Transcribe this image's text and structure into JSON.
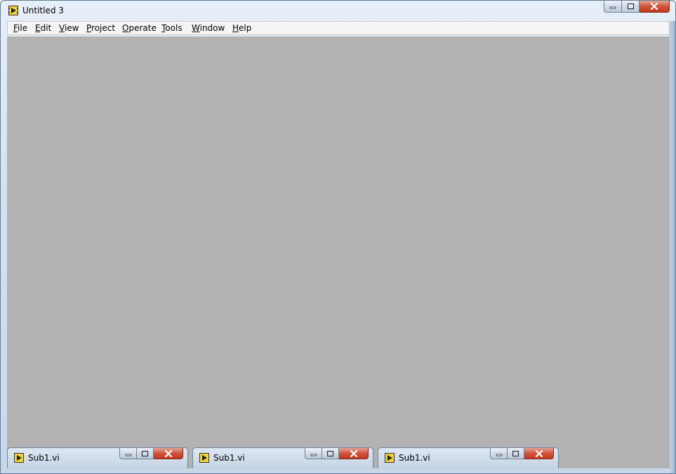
{
  "window": {
    "title": "Untitled 3",
    "app_icon": "labview-vi-icon",
    "caption_buttons": [
      "minimize-icon",
      "maximize-icon",
      "close-icon"
    ]
  },
  "menubar": {
    "items": [
      {
        "label": "File",
        "accel": "F",
        "rest": "ile"
      },
      {
        "label": "Edit",
        "accel": "E",
        "rest": "dit"
      },
      {
        "label": "View",
        "accel": "V",
        "rest": "iew"
      },
      {
        "label": "Project",
        "accel": "P",
        "rest": "roject"
      },
      {
        "label": "Operate",
        "accel": "O",
        "rest": "perate"
      },
      {
        "label": "Tools",
        "accel": "T",
        "rest": "ools"
      },
      {
        "label": "Window",
        "accel": "W",
        "rest": "indow"
      },
      {
        "label": "Help",
        "accel": "H",
        "rest": "elp"
      }
    ]
  },
  "client_area": {
    "background": "#b2b2b2"
  },
  "minimized_windows": [
    {
      "title": "Sub1.vi"
    },
    {
      "title": "Sub1.vi"
    },
    {
      "title": "Sub1.vi"
    }
  ],
  "colors": {
    "frame": "#c8d7e8",
    "close_button": "#c4391f",
    "workspace": "#b2b2b2"
  }
}
